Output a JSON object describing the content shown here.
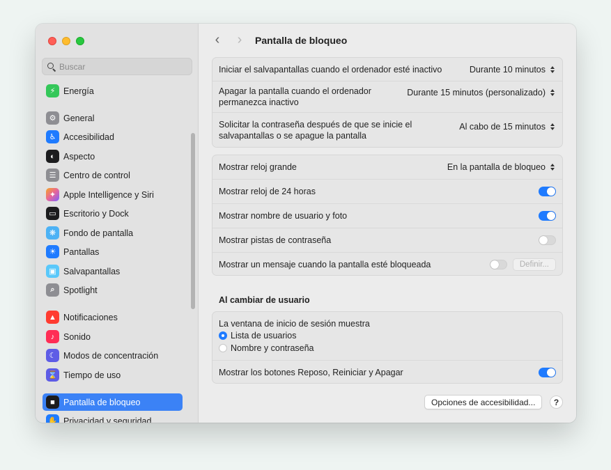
{
  "window": {
    "title": "Pantalla de bloqueo"
  },
  "sidebar": {
    "search_placeholder": "Buscar",
    "items": [
      {
        "label": "Energía",
        "icon": "energy-icon",
        "color": "#34c759",
        "glyph": "⚡"
      },
      {
        "label": "General",
        "icon": "gear-icon",
        "color": "#8e8e93",
        "glyph": "⚙"
      },
      {
        "label": "Accesibilidad",
        "icon": "accessibility-icon",
        "color": "#1f7bff",
        "glyph": "♿"
      },
      {
        "label": "Aspecto",
        "icon": "appearance-icon",
        "color": "#1c1c1e",
        "glyph": "◐"
      },
      {
        "label": "Centro de control",
        "icon": "control-center-icon",
        "color": "#8e8e93",
        "glyph": "☰"
      },
      {
        "label": "Apple Intelligence y Siri",
        "icon": "siri-icon",
        "color": "#e8659a",
        "glyph": "✦"
      },
      {
        "label": "Escritorio y Dock",
        "icon": "dock-icon",
        "color": "#1c1c1e",
        "glyph": "▭"
      },
      {
        "label": "Fondo de pantalla",
        "icon": "wallpaper-icon",
        "color": "#4db2f5",
        "glyph": "❋"
      },
      {
        "label": "Pantallas",
        "icon": "displays-icon",
        "color": "#1f7bff",
        "glyph": "☀"
      },
      {
        "label": "Salvapantallas",
        "icon": "screensaver-icon",
        "color": "#5ac8fa",
        "glyph": "▣"
      },
      {
        "label": "Spotlight",
        "icon": "spotlight-icon",
        "color": "#8e8e93",
        "glyph": "⌕"
      },
      {
        "label": "Notificaciones",
        "icon": "notifications-icon",
        "color": "#ff3b30",
        "glyph": "🔔"
      },
      {
        "label": "Sonido",
        "icon": "sound-icon",
        "color": "#ff2d55",
        "glyph": "♪"
      },
      {
        "label": "Modos de concentración",
        "icon": "focus-icon",
        "color": "#5e5ce6",
        "glyph": "☾"
      },
      {
        "label": "Tiempo de uso",
        "icon": "screen-time-icon",
        "color": "#5e5ce6",
        "glyph": "⌛"
      },
      {
        "label": "Pantalla de bloqueo",
        "icon": "lock-screen-icon",
        "color": "#1c1c1e",
        "glyph": "🔒"
      },
      {
        "label": "Privacidad y seguridad",
        "icon": "privacy-icon",
        "color": "#1f7bff",
        "glyph": "✋"
      }
    ]
  },
  "toolbar": {
    "back_glyph": "‹",
    "forward_glyph": "›",
    "title": "Pantalla de bloqueo"
  },
  "group1": {
    "rows": [
      {
        "label": "Iniciar el salvapantallas cuando el ordenador esté inactivo",
        "value": "Durante 10 minutos"
      },
      {
        "label": "Apagar la pantalla cuando el ordenador permanezca inactivo",
        "value": "Durante 15 minutos (personalizado)"
      },
      {
        "label": "Solicitar la contraseña después de que se inicie el salvapantallas o se apague la pantalla",
        "value": "Al cabo de 15 minutos"
      }
    ]
  },
  "group2": {
    "big_clock_label": "Mostrar reloj grande",
    "big_clock_value": "En la pantalla de bloqueo",
    "clock24_label": "Mostrar reloj de 24 horas",
    "clock24_on": true,
    "username_label": "Mostrar nombre de usuario y foto",
    "username_on": true,
    "hints_label": "Mostrar pistas de contraseña",
    "hints_on": false,
    "message_label": "Mostrar un mensaje cuando la pantalla esté bloqueada",
    "message_on": false,
    "set_button": "Definir..."
  },
  "switch_user": {
    "section_title": "Al cambiar de usuario",
    "login_window_label": "La ventana de inicio de sesión muestra",
    "option_list": "Lista de usuarios",
    "option_name": "Nombre y contraseña",
    "selected_option": "Lista de usuarios",
    "power_buttons_label": "Mostrar los botones Reposo, Reiniciar y Apagar",
    "power_buttons_on": true
  },
  "footer": {
    "accessibility_button": "Opciones de accesibilidad...",
    "help_glyph": "?"
  },
  "colors": {
    "accent": "#1f7bff",
    "selection": "#3b82f6"
  }
}
